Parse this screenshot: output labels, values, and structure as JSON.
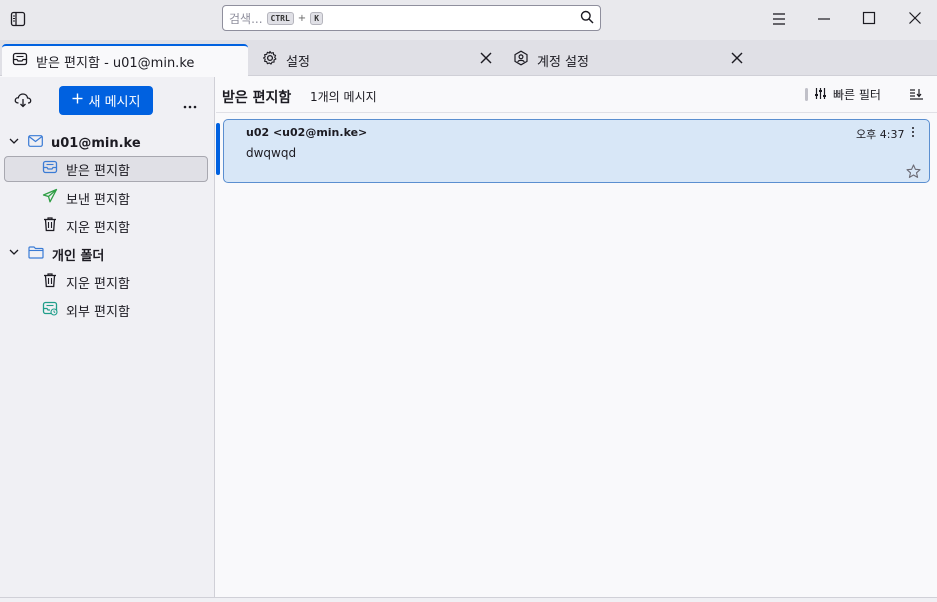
{
  "search": {
    "placeholder": "검색...",
    "kbd_ctrl": "CTRL",
    "kbd_plus": "+",
    "kbd_k": "K"
  },
  "tabs": [
    {
      "label": "받은 편지함 - u01@min.ke",
      "icon": "inbox-icon"
    },
    {
      "label": "설정",
      "icon": "gear-icon"
    },
    {
      "label": "계정 설정",
      "icon": "account-settings-icon"
    }
  ],
  "sidebar": {
    "new_message": "새 메시지",
    "account": "u01@min.ke",
    "account_folders": [
      "받은 편지함",
      "보낸 편지함",
      "지운 편지함"
    ],
    "local_group": "개인 폴더",
    "local_folders": [
      "지운 편지함",
      "외부 편지함"
    ]
  },
  "main": {
    "folder_title": "받은 편지함",
    "message_count": "1개의 메시지",
    "quick_filter": "빠른 필터"
  },
  "messages": [
    {
      "sender": "u02 <u02@min.ke>",
      "time": "오후 4:37",
      "subject": "dwqwqd"
    }
  ],
  "colors": {
    "accent": "#0061e0",
    "selected_message": "#d8e7f7"
  }
}
